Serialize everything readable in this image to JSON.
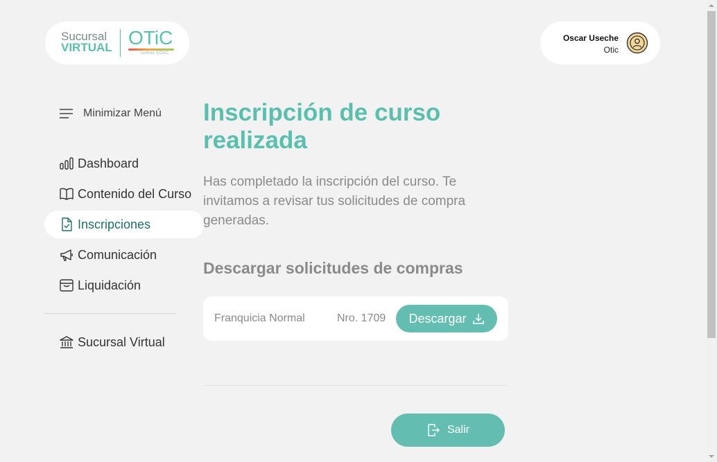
{
  "logo": {
    "line1": "Sucursal",
    "line2": "VIRTUAL",
    "brand": "OTiC",
    "tagline": "somos CChC"
  },
  "user": {
    "name": "Oscar Useche",
    "org": "Otic",
    "avatar_icon": "user-circle-icon"
  },
  "sidebar": {
    "toggle_label": "Minimizar Menú",
    "items": [
      {
        "label": "Dashboard",
        "icon": "bar-chart-icon"
      },
      {
        "label": "Contenido del Curso",
        "icon": "book-icon"
      },
      {
        "label": "Inscripciones",
        "icon": "document-check-icon",
        "active": true
      },
      {
        "label": "Comunicación",
        "icon": "megaphone-icon"
      },
      {
        "label": "Liquidación",
        "icon": "archive-box-icon"
      }
    ],
    "footer_item": {
      "label": "Sucursal Virtual",
      "icon": "bank-building-icon"
    }
  },
  "main": {
    "title": "Inscripción de curso realizada",
    "description": "Has completado la inscripción del curso. Te invitamos a revisar tus solicitudes de compra generadas.",
    "section_title": "Descargar solicitudes de compras",
    "request": {
      "name": "Franquicia Normal",
      "number": "Nro. 1709",
      "download_label": "Descargar"
    },
    "exit_label": "Salir"
  },
  "colors": {
    "accent": "#5bbfae",
    "button": "#63bdb0",
    "background": "#f2f2f2",
    "active_text": "#1f6f6a"
  }
}
